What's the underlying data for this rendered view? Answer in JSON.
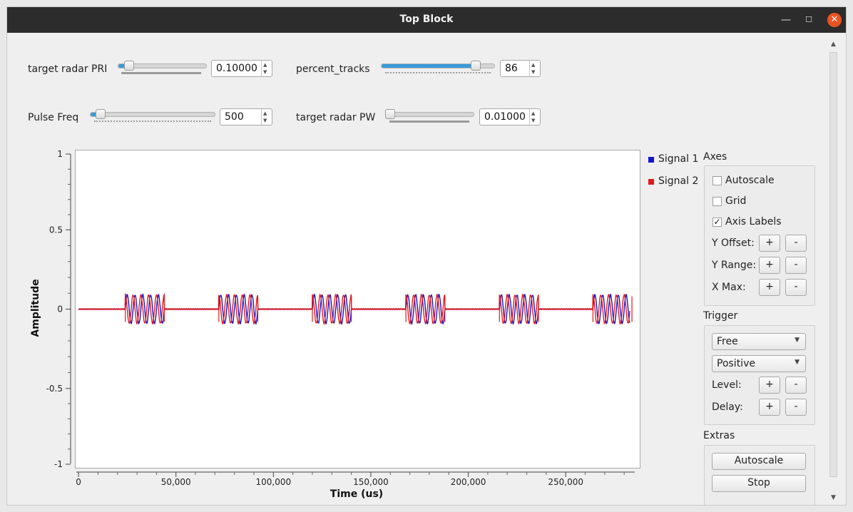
{
  "window": {
    "title": "Top Block"
  },
  "controls": {
    "pri": {
      "label": "target radar PRI",
      "value": "0.10000"
    },
    "percent_tracks": {
      "label": "percent_tracks",
      "value": "86",
      "level": 0.86
    },
    "pulse_freq": {
      "label": "Pulse Freq",
      "value": "500"
    },
    "pw": {
      "label": "target radar PW",
      "value": "0.01000"
    }
  },
  "chart_data": {
    "type": "line",
    "xlabel": "Time (us)",
    "ylabel": "Amplitude",
    "ylim": [
      -1,
      1
    ],
    "xlim": [
      -1500,
      288000
    ],
    "yticks": [
      "1",
      "0.5",
      "0",
      "-0.5",
      "-1"
    ],
    "xticks": [
      "0",
      "50,000",
      "100,000",
      "150,000",
      "200,000",
      "250,000"
    ],
    "xtick_values": [
      0,
      50000,
      100000,
      150000,
      200000,
      250000
    ],
    "ytick_values": [
      1,
      0.5,
      0,
      -0.5,
      -1
    ],
    "grid": false,
    "legend_position": "right",
    "pulse_starts_us": [
      24000,
      72000,
      120000,
      168000,
      216000,
      264000
    ],
    "pulse_width_us": 20000,
    "pulse_amplitude": 0.09,
    "cycles_per_pulse": 5,
    "series": [
      {
        "name": "Signal 1",
        "color": "#1414d2"
      },
      {
        "name": "Signal 2",
        "color": "#e01b1b"
      }
    ]
  },
  "panel": {
    "axes": {
      "title": "Axes",
      "autoscale": "Autoscale",
      "grid": "Grid",
      "axis_labels": "Axis Labels",
      "axis_labels_check": "✓",
      "y_offset": "Y Offset:",
      "y_range": "Y Range:",
      "x_max": "X Max:"
    },
    "trigger": {
      "title": "Trigger",
      "mode": "Free",
      "slope": "Positive",
      "level": "Level:",
      "delay": "Delay:"
    },
    "extras": {
      "title": "Extras",
      "autoscale_btn": "Autoscale",
      "stop_btn": "Stop"
    },
    "plus": "+",
    "minus": "-"
  }
}
